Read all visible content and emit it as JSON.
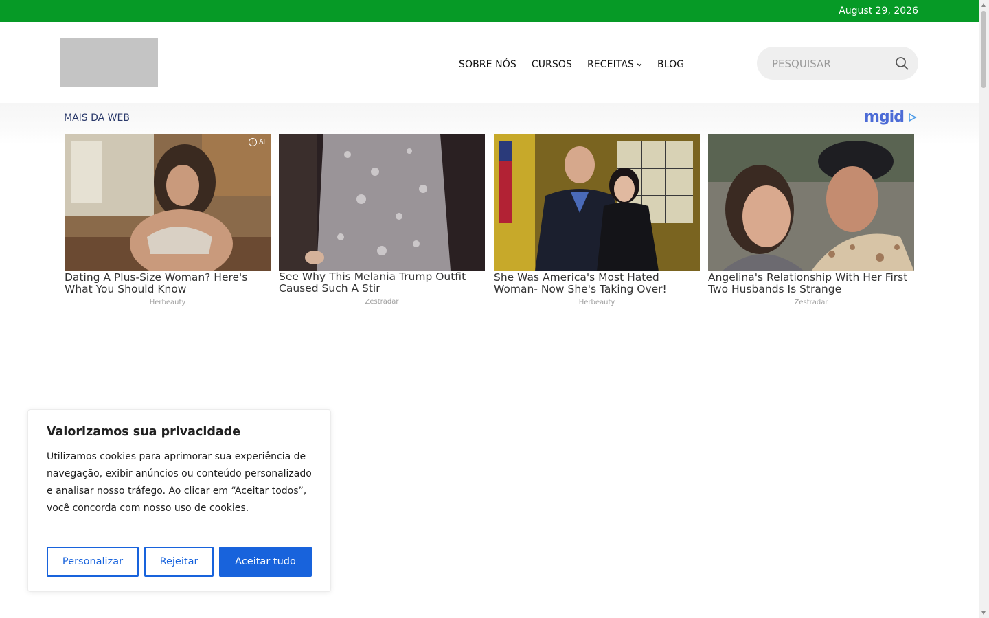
{
  "topbar": {
    "date": "August 29, 2026"
  },
  "nav": {
    "items": [
      {
        "label": "SOBRE NÓS"
      },
      {
        "label": "CURSOS"
      },
      {
        "label": "RECEITAS"
      },
      {
        "label": "BLOG"
      }
    ]
  },
  "search": {
    "placeholder": "PESQUISAR"
  },
  "ads": {
    "label": "MAIS DA WEB",
    "brand": "mgid",
    "ai_badge": "AI",
    "cards": [
      {
        "title": "Dating A Plus-Size Woman? Here's What You Should Know",
        "source": "Herbeauty"
      },
      {
        "title": "See Why This Melania Trump Outfit Caused Such A Stir",
        "source": "Zestradar"
      },
      {
        "title": "She Was America's Most Hated Woman- Now She's Taking Over!",
        "source": "Herbeauty"
      },
      {
        "title": "Angelina's Relationship With Her First Two Husbands Is Strange",
        "source": "Zestradar"
      }
    ]
  },
  "cookie": {
    "title": "Valorizamos sua privacidade",
    "text": "Utilizamos cookies para aprimorar sua experiência de navegação, exibir anúncios ou conteúdo personalizado e analisar nosso tráfego. Ao clicar em “Aceitar todos”, você concorda com nosso uso de cookies.",
    "customize": "Personalizar",
    "reject": "Rejeitar",
    "accept": "Aceitar tudo"
  },
  "colors": {
    "topbar": "#069a26",
    "accent": "#1863dc",
    "search_bg": "#efefef"
  }
}
